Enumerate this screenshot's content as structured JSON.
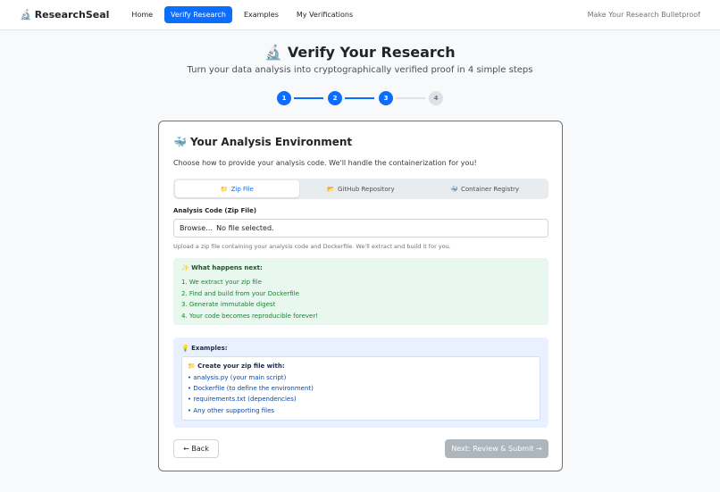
{
  "nav": {
    "brand": "ResearchSeal",
    "brand_icon": "🔬",
    "links": [
      "Home",
      "Verify Research",
      "Examples",
      "My Verifications"
    ],
    "active_link": "Verify Research",
    "tagline": "Make Your Research Bulletproof"
  },
  "page": {
    "title_icon": "🔬",
    "title": "Verify Your Research",
    "subtitle": "Turn your data analysis into cryptographically verified proof in 4 simple steps"
  },
  "stepper": {
    "steps": [
      "1",
      "2",
      "3",
      "4"
    ],
    "current_step": 3
  },
  "card": {
    "title_icon": "🐳",
    "title": "Your Analysis Environment",
    "description": "Choose how to provide your analysis code. We'll handle the containerization for you!",
    "tabs": [
      {
        "icon": "📁",
        "label": "Zip File"
      },
      {
        "icon": "📂",
        "label": "GitHub Repository"
      },
      {
        "icon": "🐳",
        "label": "Container Registry"
      }
    ],
    "active_tab": "Zip File",
    "field_label": "Analysis Code (Zip File)",
    "file_input": {
      "browse_label": "Browse…",
      "status": "No file selected."
    },
    "help_text": "Upload a zip file containing your analysis code and Dockerfile. We'll extract and build it for you.",
    "next_box": {
      "title": "✨ What happens next:",
      "items": [
        "1. We extract your zip file",
        "2. Find and build from your Dockerfile",
        "3. Generate immutable digest",
        "4. Your code becomes reproducible forever!"
      ]
    },
    "examples_box": {
      "title": "💡 Examples:",
      "inner_title": "📁 Create your zip file with:",
      "items": [
        "• analysis.py (your main script)",
        "• Dockerfile (to define the environment)",
        "• requirements.txt (dependencies)",
        "• Any other supporting files"
      ]
    },
    "back_label": "← Back",
    "next_label": "Next: Review & Submit →"
  },
  "colors": {
    "primary": "#0d6efd",
    "disabled": "#adb5bd",
    "success_bg": "#e8f8ee",
    "info_bg": "#e8f1fd"
  }
}
